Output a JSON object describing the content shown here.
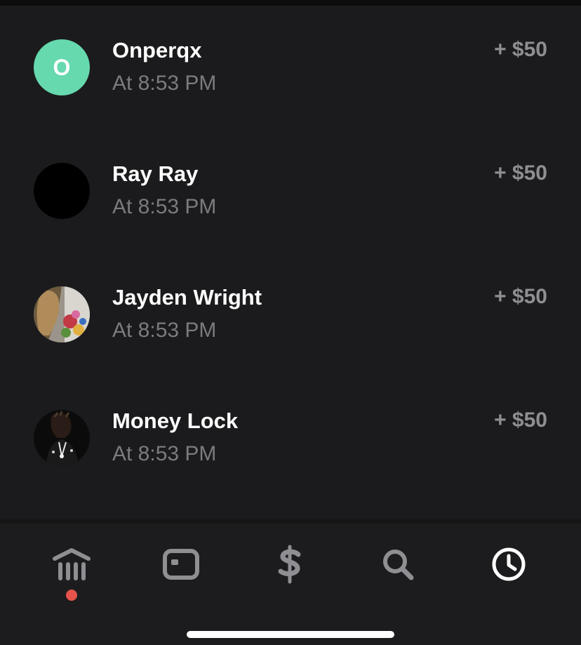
{
  "colors": {
    "background": "#1b1b1d",
    "name_text": "#ffffff",
    "secondary_text": "#7b7b7f",
    "amount_text": "#8e8e93",
    "tab_inactive": "#8e8e93",
    "tab_active": "#ffffff",
    "notification_dot": "#e5534b",
    "initial_avatar_bg": "#66d9ae"
  },
  "activity": [
    {
      "name": "Onperqx",
      "time": "At 8:53 PM",
      "amount": "+ $50",
      "avatar_initial": "O",
      "avatar_type": "initial"
    },
    {
      "name": "Ray Ray",
      "time": "At 8:53 PM",
      "amount": "+ $50",
      "avatar_type": "photo-black"
    },
    {
      "name": "Jayden Wright",
      "time": "At 8:53 PM",
      "amount": "+ $50",
      "avatar_type": "photo"
    },
    {
      "name": "Money Lock",
      "time": "At 8:53 PM",
      "amount": "+ $50",
      "avatar_type": "photo"
    }
  ],
  "tabbar": {
    "tabs": [
      {
        "icon": "bank-icon",
        "active": false,
        "has_notification": true
      },
      {
        "icon": "card-icon",
        "active": false
      },
      {
        "icon": "dollar-icon",
        "active": false
      },
      {
        "icon": "search-icon",
        "active": false
      },
      {
        "icon": "clock-icon",
        "active": true
      }
    ]
  }
}
